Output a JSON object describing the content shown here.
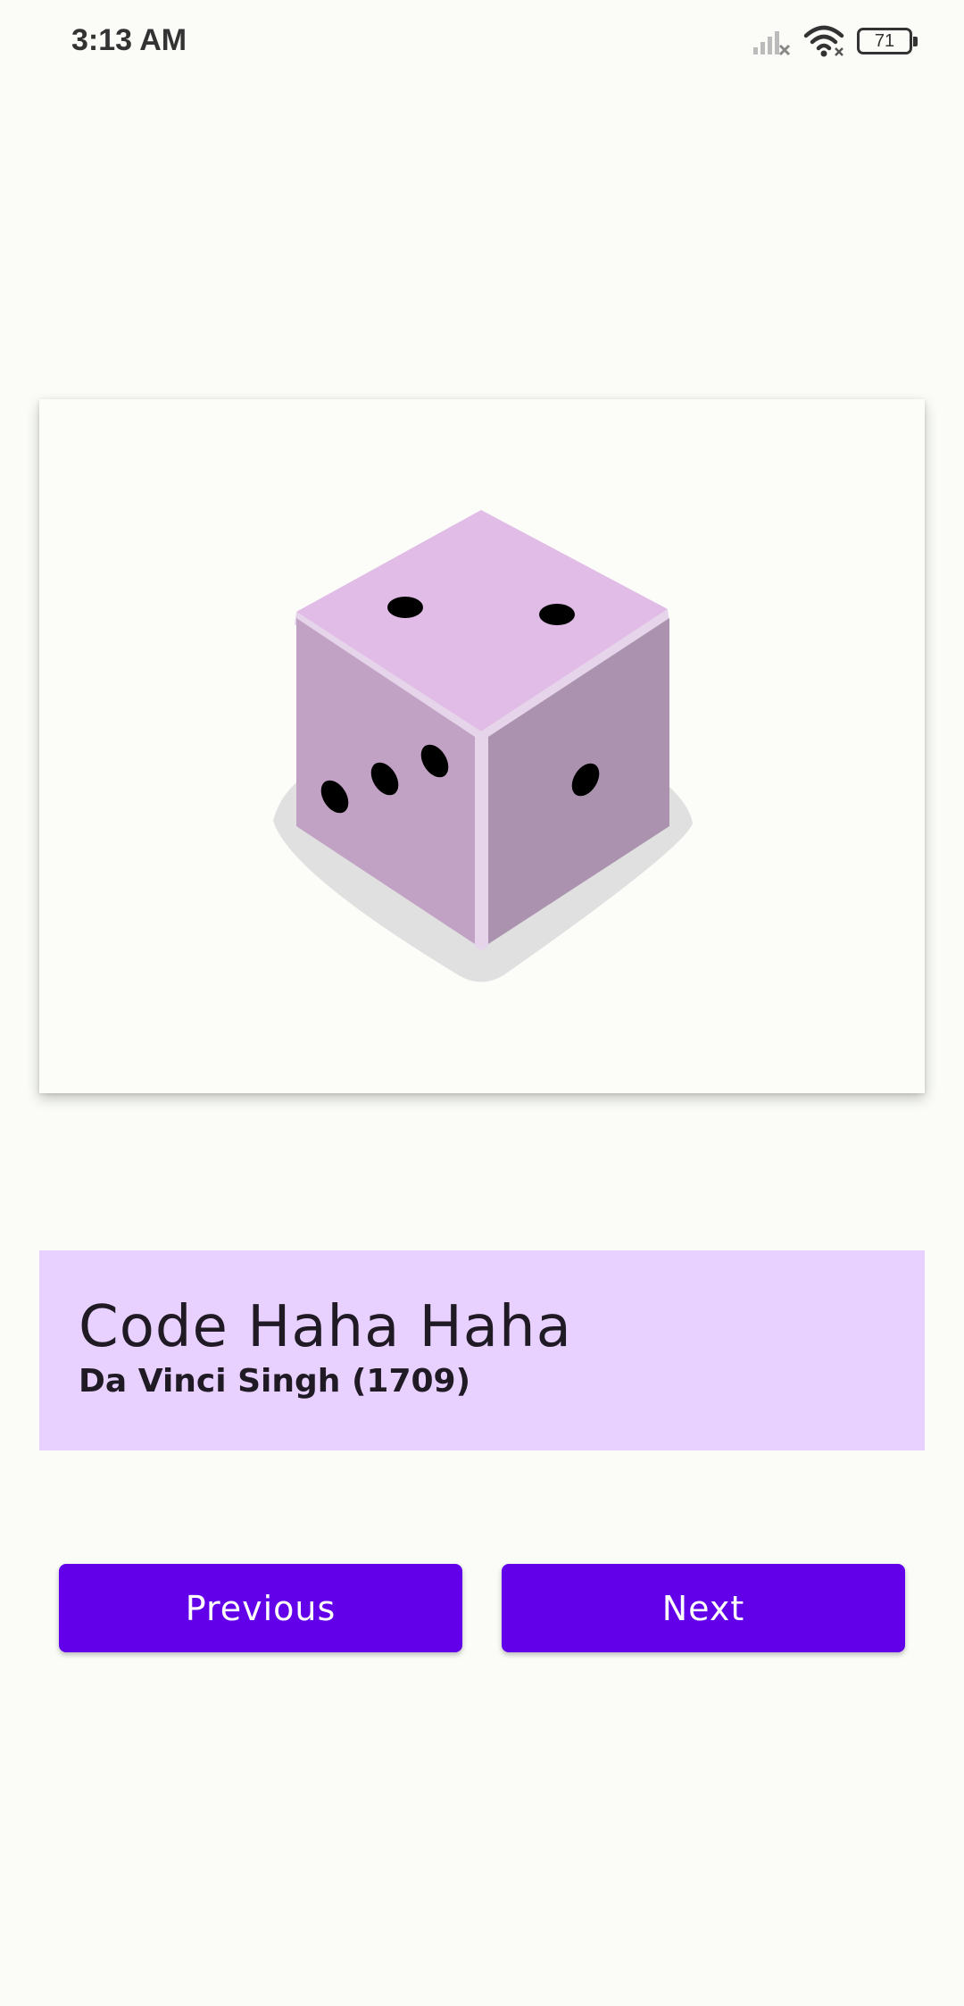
{
  "status_bar": {
    "time": "3:13 AM",
    "battery_level": "71",
    "icons": [
      "signal-icon",
      "wifi-icon",
      "battery-icon"
    ]
  },
  "artwork": {
    "image_icon": "dice-icon",
    "title": "Code Haha Haha",
    "subtitle": "Da Vinci Singh (1709)"
  },
  "navigation": {
    "previous_label": "Previous",
    "next_label": "Next"
  },
  "colors": {
    "background": "#fbfcf8",
    "panel": "#e8d0ff",
    "button": "#6200ea",
    "button_text": "#ffffff"
  }
}
